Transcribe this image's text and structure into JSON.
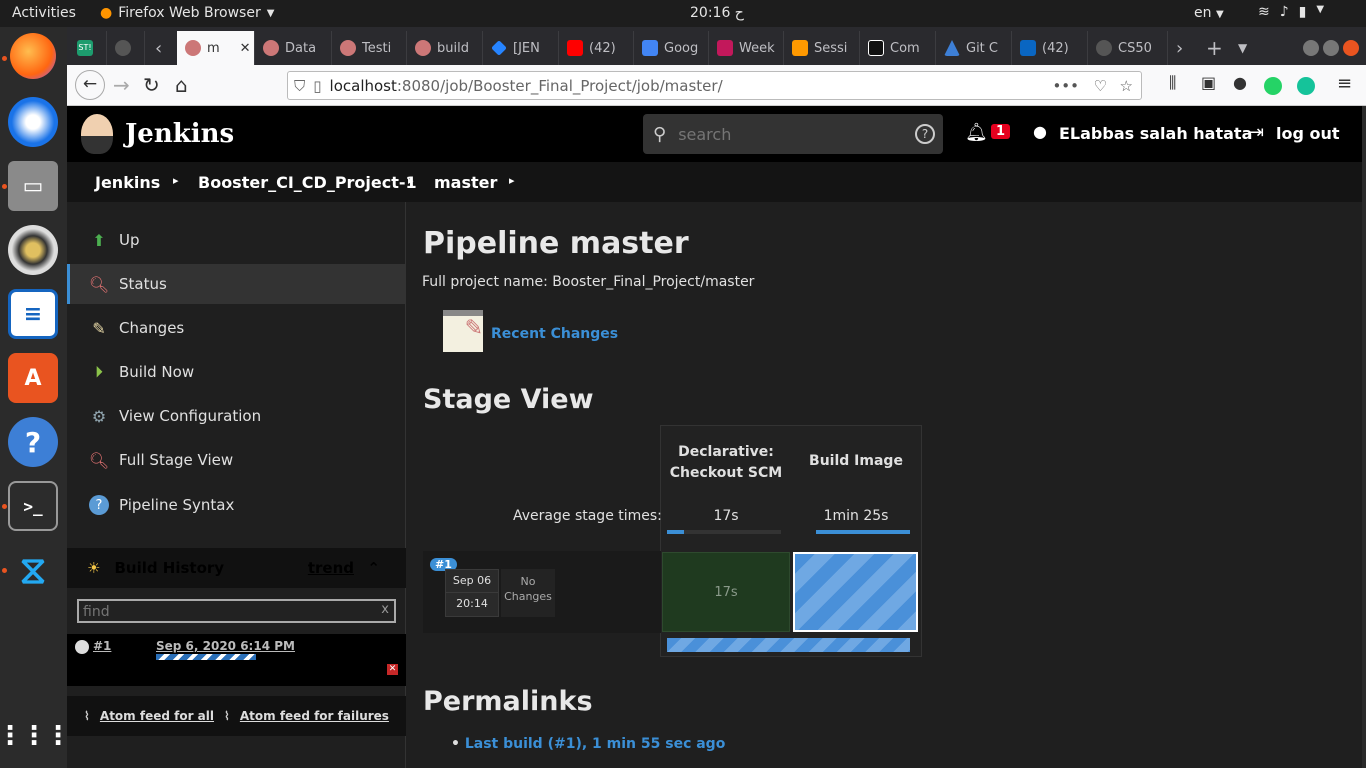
{
  "topbar": {
    "activities": "Activities",
    "app_name": "Firefox Web Browser",
    "clock": "20:16 ح",
    "lang": "en"
  },
  "dock": {
    "items": [
      "firefox-icon",
      "thunderbird-icon",
      "files-icon",
      "rhythmbox-icon",
      "libreoffice-writer-icon",
      "software-icon",
      "help-icon",
      "terminal-icon",
      "vscode-icon",
      "apps-grid-icon"
    ]
  },
  "tabs": [
    {
      "label": "",
      "icon": "st-icon"
    },
    {
      "label": "",
      "icon": "github-icon"
    },
    {
      "label": "m",
      "icon": "jenkins-icon"
    },
    {
      "label": "Data",
      "icon": "jenkins-icon"
    },
    {
      "label": "Testi",
      "icon": "jenkins-icon"
    },
    {
      "label": "build",
      "icon": "jenkins-icon"
    },
    {
      "label": "[JEN",
      "icon": "jira-icon"
    },
    {
      "label": "(42)",
      "icon": "youtube-icon"
    },
    {
      "label": "Goog",
      "icon": "google-icon"
    },
    {
      "label": "Week",
      "icon": "week-icon"
    },
    {
      "label": "Sessi",
      "icon": "aws-icon"
    },
    {
      "label": "Com",
      "icon": "hackerrank-icon"
    },
    {
      "label": "Git C",
      "icon": "git-icon"
    },
    {
      "label": "(42)",
      "icon": "linkedin-icon"
    },
    {
      "label": "CS50",
      "icon": "github-icon"
    }
  ],
  "url": {
    "host": "localhost",
    "rest": ":8080/job/Booster_Final_Project/job/master/"
  },
  "jenkins": {
    "logo_text": "Jenkins",
    "search_placeholder": "search",
    "notif_count": "1",
    "user": "ELabbas salah hatata",
    "logout": "log out",
    "breadcrumb": [
      "Jenkins",
      "Booster_CI_CD_Project-1",
      "master"
    ],
    "tasks": [
      "Up",
      "Status",
      "Changes",
      "Build Now",
      "View Configuration",
      "Full Stage View",
      "Pipeline Syntax"
    ],
    "build_history": {
      "title": "Build History",
      "trend": "trend",
      "find_placeholder": "find",
      "clear": "x",
      "builds": [
        {
          "num": "#1",
          "date": "Sep 6, 2020 6:14 PM"
        }
      ],
      "atom_all": "Atom feed for all",
      "atom_failures": "Atom feed for failures"
    },
    "main": {
      "title": "Pipeline master",
      "full_name": "Full project name: Booster_Final_Project/master",
      "recent_changes": "Recent Changes",
      "stage_view": "Stage View",
      "stages": [
        {
          "name_line1": "Declarative:",
          "name_line2": "Checkout SCM",
          "avg": "17s",
          "time": "17s",
          "progress": 0.15
        },
        {
          "name_line1": "Build Image",
          "name_line2": "",
          "avg": "1min 25s",
          "time": "",
          "progress": 1.0
        }
      ],
      "avg_label": "Average stage times:",
      "run": {
        "badge": "#1",
        "date": "Sep 06",
        "time": "20:14",
        "changes_line1": "No",
        "changes_line2": "Changes"
      },
      "permalinks": "Permalinks",
      "last_build": "Last build (#1), 1 min 55 sec ago"
    }
  },
  "colors": {
    "accent": "#3b8fd6",
    "notif": "#e6001f",
    "stage_ok": "#1f3a1f",
    "stage_running": "#4a90d9"
  }
}
